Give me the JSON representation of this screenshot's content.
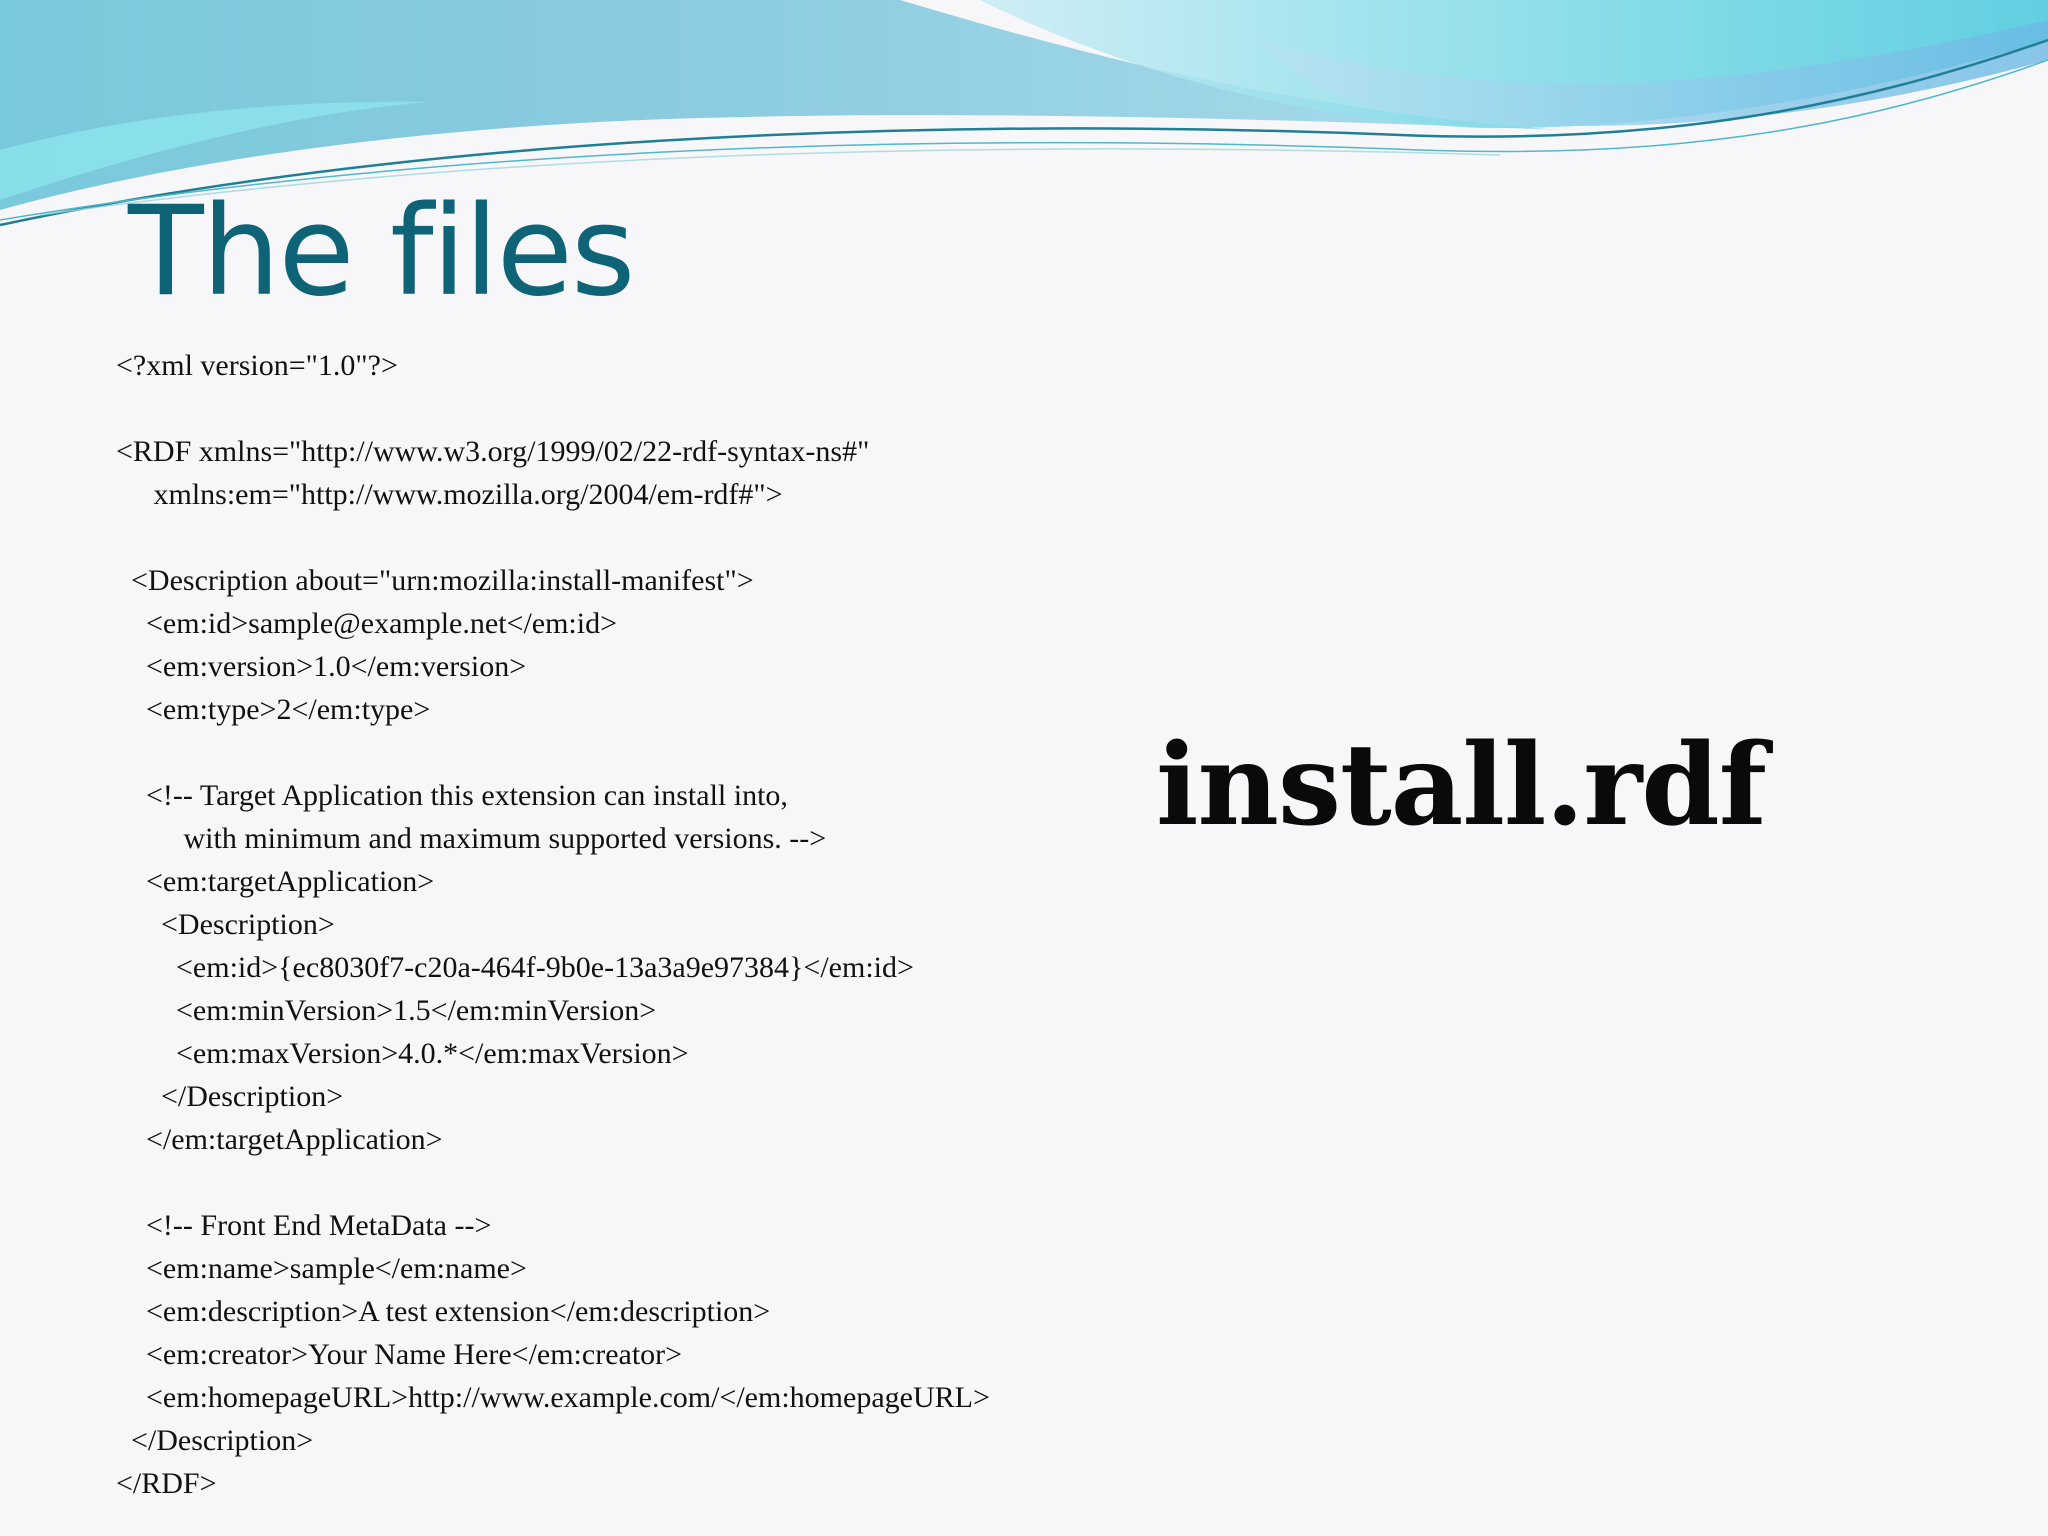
{
  "slide": {
    "title": "The files",
    "side_label": "install.rdf",
    "code_lines": [
      "<?xml version=\"1.0\"?>",
      "",
      "<RDF xmlns=\"http://www.w3.org/1999/02/22-rdf-syntax-ns#\"",
      "     xmlns:em=\"http://www.mozilla.org/2004/em-rdf#\">",
      "",
      "  <Description about=\"urn:mozilla:install-manifest\">",
      "    <em:id>sample@example.net</em:id>",
      "    <em:version>1.0</em:version>",
      "    <em:type>2</em:type>",
      "",
      "    <!-- Target Application this extension can install into,",
      "         with minimum and maximum supported versions. -->",
      "    <em:targetApplication>",
      "      <Description>",
      "        <em:id>{ec8030f7-c20a-464f-9b0e-13a3a9e97384}</em:id>",
      "        <em:minVersion>1.5</em:minVersion>",
      "        <em:maxVersion>4.0.*</em:maxVersion>",
      "      </Description>",
      "    </em:targetApplication>",
      "",
      "    <!-- Front End MetaData -->",
      "    <em:name>sample</em:name>",
      "    <em:description>A test extension</em:description>",
      "    <em:creator>Your Name Here</em:creator>",
      "    <em:homepageURL>http://www.example.com/</em:homepageURL>",
      "  </Description>",
      "</RDF>"
    ]
  },
  "theme": {
    "title_color": "#0e6377",
    "wave_light": "#7fd6e6",
    "wave_mid": "#5cc2d8",
    "wave_dark": "#2a8fa8",
    "background": "#f7f7f9"
  }
}
